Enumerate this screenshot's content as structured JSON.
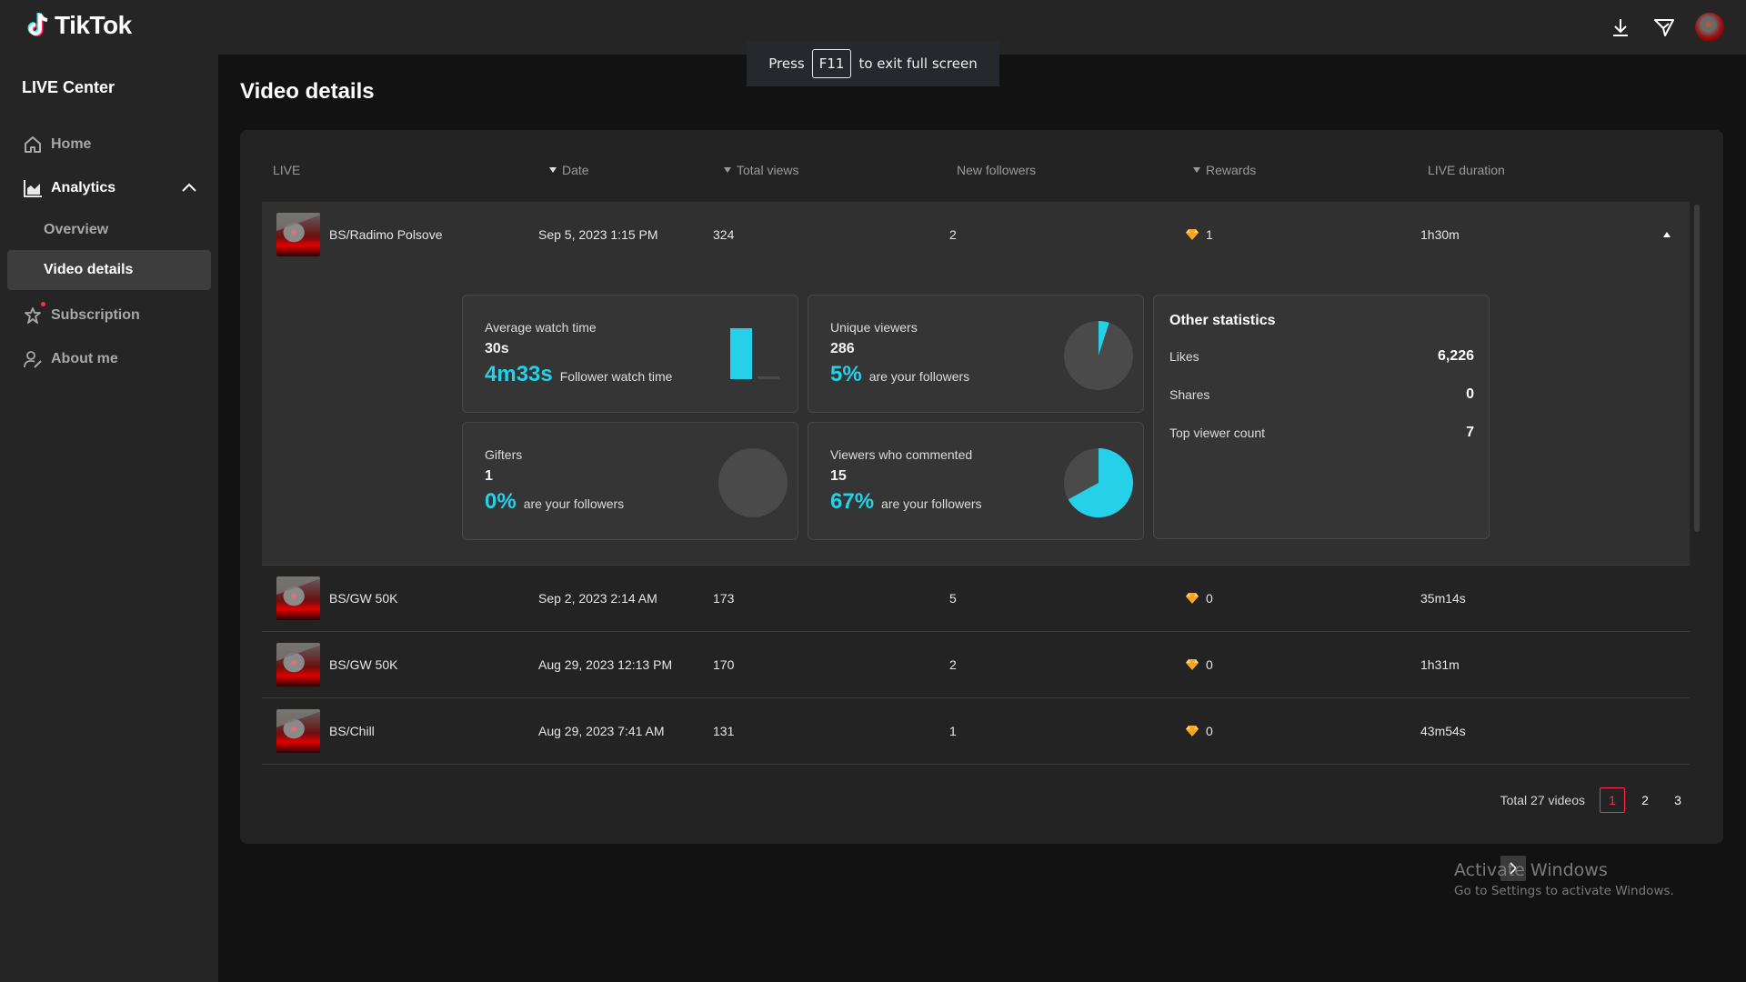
{
  "app": {
    "brand": "TikTok"
  },
  "fullscreen_toast": {
    "before": "Press",
    "key": "F11",
    "after": "to exit full screen"
  },
  "topbar": {
    "icons": [
      "download-icon",
      "send-icon",
      "avatar"
    ]
  },
  "sidebar": {
    "title": "LIVE Center",
    "items": [
      {
        "label": "Home",
        "icon": "home-icon"
      },
      {
        "label": "Analytics",
        "icon": "chart-icon",
        "expanded": true,
        "children": [
          {
            "label": "Overview"
          },
          {
            "label": "Video details",
            "selected": true
          }
        ]
      },
      {
        "label": "Subscription",
        "icon": "star-icon",
        "badge_dot": true
      },
      {
        "label": "About me",
        "icon": "user-edit-icon"
      }
    ]
  },
  "page": {
    "title": "Video details"
  },
  "table": {
    "columns": [
      {
        "label": "LIVE",
        "sort": null
      },
      {
        "label": "Date",
        "sort": "desc-active"
      },
      {
        "label": "Total views",
        "sort": "desc"
      },
      {
        "label": "New followers",
        "sort": null
      },
      {
        "label": "Rewards",
        "sort": "desc"
      },
      {
        "label": "LIVE duration",
        "sort": null
      }
    ],
    "rows": [
      {
        "title": "BS/Radimo Polsove",
        "date": "Sep 5, 2023 1:15 PM",
        "views": "324",
        "followers": "2",
        "rewards": "1",
        "duration": "1h30m",
        "expanded": true
      },
      {
        "title": "BS/GW 50K",
        "date": "Sep 2, 2023 2:14 AM",
        "views": "173",
        "followers": "5",
        "rewards": "0",
        "duration": "35m14s"
      },
      {
        "title": "BS/GW 50K",
        "date": "Aug 29, 2023 12:13 PM",
        "views": "170",
        "followers": "2",
        "rewards": "0",
        "duration": "1h31m"
      },
      {
        "title": "BS/Chill",
        "date": "Aug 29, 2023 7:41 AM",
        "views": "131",
        "followers": "1",
        "rewards": "0",
        "duration": "43m54s"
      }
    ]
  },
  "details": {
    "avg_watch": {
      "label": "Average watch time",
      "value": "30s",
      "follower_value": "4m33s",
      "follower_label": "Follower watch time",
      "bars_seconds": [
        273,
        30
      ]
    },
    "unique_viewers": {
      "label": "Unique viewers",
      "value": "286",
      "pct": "5%",
      "pct_label": "are your followers",
      "fraction": 0.05
    },
    "gifters": {
      "label": "Gifters",
      "value": "1",
      "pct": "0%",
      "pct_label": "are your followers",
      "fraction": 0
    },
    "commenters": {
      "label": "Viewers who commented",
      "value": "15",
      "pct": "67%",
      "pct_label": "are your followers",
      "fraction": 0.67
    },
    "other": {
      "title": "Other statistics",
      "rows": [
        {
          "label": "Likes",
          "value": "6,226"
        },
        {
          "label": "Shares",
          "value": "0"
        },
        {
          "label": "Top viewer count",
          "value": "7"
        }
      ]
    }
  },
  "pagination": {
    "total": "Total 27 videos",
    "pages": [
      "1",
      "2",
      "3"
    ],
    "current": "1"
  },
  "watermark": {
    "line1": "Activate Windows",
    "line2": "Go to Settings to activate Windows."
  },
  "colors": {
    "accent": "#25d0e8",
    "brand_red": "#fe2c55",
    "gem": "#f5a623"
  }
}
